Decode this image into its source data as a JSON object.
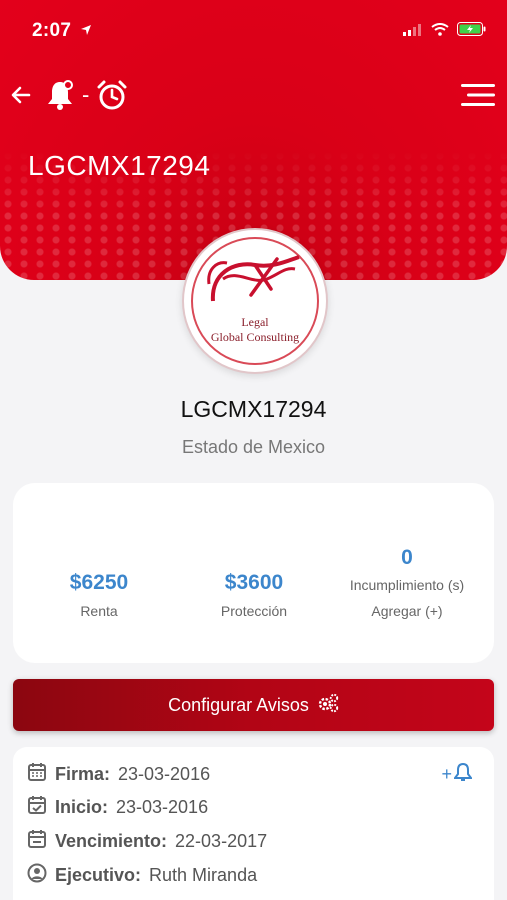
{
  "status_bar": {
    "time": "2:07"
  },
  "nav": {
    "separator": "-"
  },
  "header": {
    "title": "LGCMX17294"
  },
  "logo": {
    "line1": "Legal",
    "line2": "Global Consulting"
  },
  "profile": {
    "name": "LGCMX17294",
    "location": "Estado de Mexico"
  },
  "stats": [
    {
      "value": "$6250",
      "label": "Renta"
    },
    {
      "value": "$3600",
      "label": "Protección"
    },
    {
      "value": "0",
      "label": "Incumplimiento (s)",
      "action": "Agregar (+)"
    }
  ],
  "config_button": {
    "label": "Configurar Avisos"
  },
  "details": {
    "add_alert_label": "+",
    "rows": [
      {
        "label": "Firma:",
        "value": "23-03-2016"
      },
      {
        "label": "Inicio:",
        "value": "23-03-2016"
      },
      {
        "label": "Vencimiento:",
        "value": "22-03-2017"
      },
      {
        "label": "Ejecutivo:",
        "value": "Ruth Miranda"
      }
    ]
  },
  "colors": {
    "brand_red": "#e3001b",
    "button_dark": "#8b0610",
    "accent_blue": "#3c86cc"
  },
  "icons": [
    "location-arrow-icon",
    "signal-icon",
    "wifi-icon",
    "battery-icon",
    "back-arrow-icon",
    "bell-icon",
    "alarm-clock-icon",
    "hamburger-menu-icon",
    "gears-icon",
    "calendar-icon",
    "calendar-check-icon",
    "calendar-minus-icon",
    "user-circle-icon"
  ]
}
